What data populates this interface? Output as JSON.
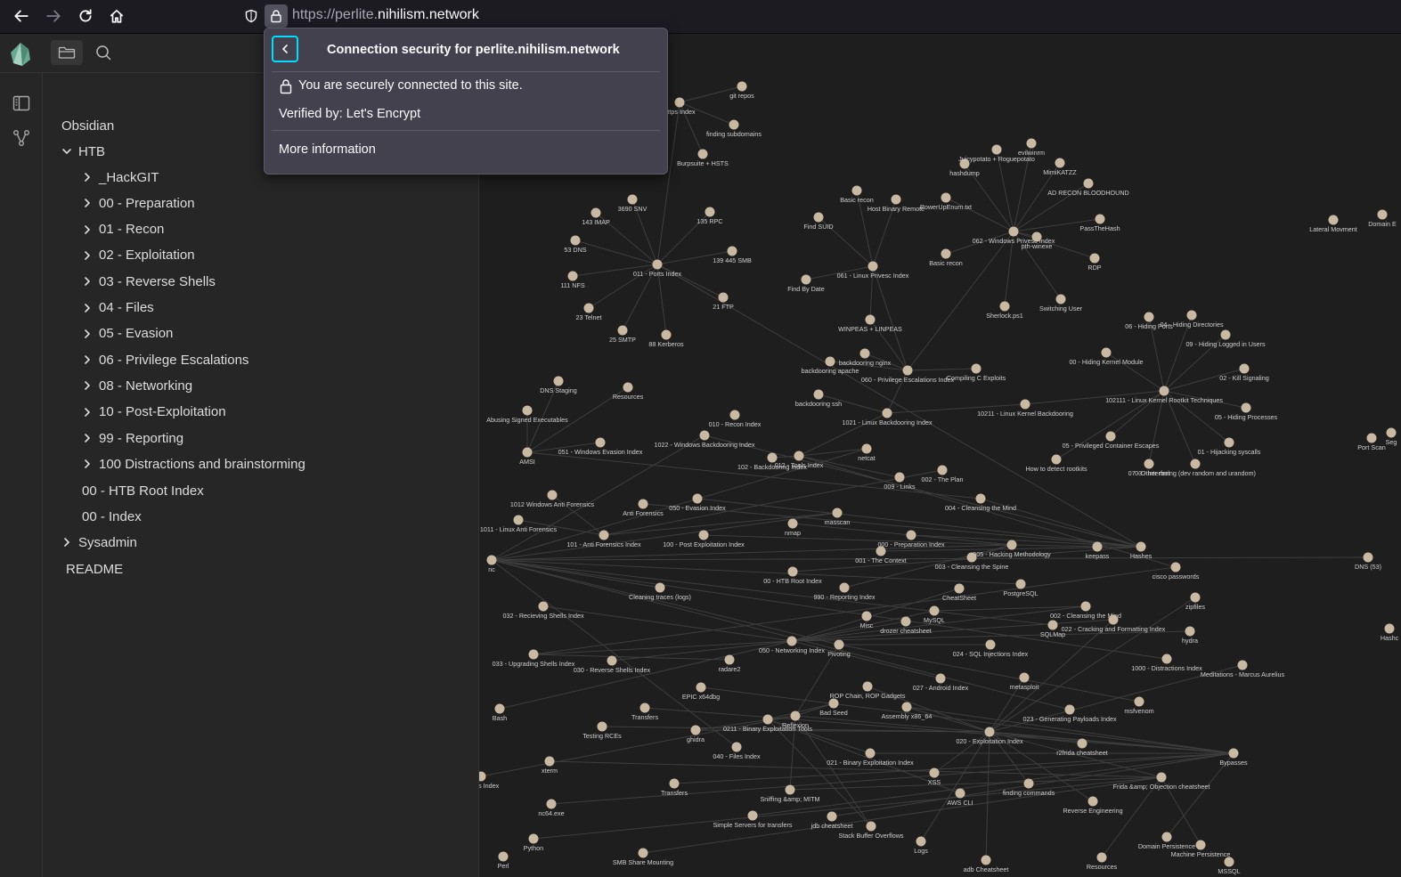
{
  "browser": {
    "url_dim_prefix": "https://perlite.",
    "url_domain": "nihilism.network"
  },
  "popup": {
    "title": "Connection security for perlite.nihilism.network",
    "secure_text": "You are securely connected to this site.",
    "verified_text": "Verified by: Let's Encrypt",
    "more_info": "More information"
  },
  "sidebar": {
    "root": "Obsidian",
    "htb": "HTB",
    "folders": [
      "_HackGIT",
      "00 - Preparation",
      "01 - Recon",
      "02 - Exploitation",
      "03 - Reverse Shells",
      "04 - Files",
      "05 - Evasion",
      "06 - Privilege Escalations",
      "08 - Networking",
      "10 - Post-Exploitation",
      "99 - Reporting",
      "100 Distractions and brainstorming"
    ],
    "files": [
      "00 - HTB Root Index",
      "00 - Index"
    ],
    "sysadmin": "Sysadmin",
    "readme": "README"
  },
  "graph": {
    "node_color": "#c9b9a3",
    "edge_color": "#3e3e3e",
    "label_color": "#cfcfcf",
    "nodes": [
      [
        "git repos",
        833,
        97
      ],
      [
        "https Index",
        763,
        115
      ],
      [
        "finding subdomains",
        824,
        140
      ],
      [
        "Burpsuite + HSTS",
        789,
        173
      ],
      [
        "3690 SNV",
        710,
        224
      ],
      [
        "143 IMAP",
        669,
        239
      ],
      [
        "135 RPC",
        797,
        238
      ],
      [
        "53 DNS",
        646,
        270
      ],
      [
        "139 445 SMB",
        822,
        282
      ],
      [
        "011 - Ports Index",
        738,
        297
      ],
      [
        "111 NFS",
        643,
        310
      ],
      [
        "21 FTP",
        812,
        334
      ],
      [
        "23 Telnet",
        661,
        346
      ],
      [
        "25 SMTP",
        699,
        371
      ],
      [
        "88 Kerberos",
        748,
        376
      ],
      [
        "hashdump",
        1083,
        184
      ],
      [
        "Juicypotato + Roguepotato",
        1119,
        168
      ],
      [
        "evilwinrm",
        1158,
        161
      ],
      [
        "MimiKATZZ",
        1190,
        183
      ],
      [
        "AD RECON BLOODHOUND",
        1222,
        206
      ],
      [
        "Basic recon",
        962,
        214
      ],
      [
        "Host Binary Remote",
        1006,
        224
      ],
      [
        "PowerUpEnum.txt",
        1062,
        222
      ],
      [
        "Find SUID",
        919,
        244
      ],
      [
        "PassTheHash",
        1235,
        246
      ],
      [
        "062 - Windows Privesc Index",
        1138,
        260
      ],
      [
        "pth-winexe",
        1164,
        266
      ],
      [
        "Basic recon",
        1062,
        285
      ],
      [
        "RDP",
        1229,
        290
      ],
      [
        "061 - Linux Privesc Index",
        980,
        299
      ],
      [
        "Find By Date",
        905,
        314
      ],
      [
        "Switching User",
        1191,
        336
      ],
      [
        "Sherlock.ps1",
        1128,
        344
      ],
      [
        "WINPEAS + LINPEAS",
        977,
        359
      ],
      [
        "backdooring nginx",
        971,
        397
      ],
      [
        "backdooring apache",
        932,
        406
      ],
      [
        "060 - Privilege Escalations Index",
        1019,
        416
      ],
      [
        "Compiling C Exploits",
        1096,
        414
      ],
      [
        "backdooring ssh",
        919,
        443
      ],
      [
        "1021 - Linux Backdooring Index",
        996,
        464
      ],
      [
        "10211 - Linux Kernel Backdooring",
        1151,
        454
      ],
      [
        "06 - Hiding Ports",
        1290,
        356
      ],
      [
        "04 - Hiding Directories",
        1338,
        354
      ],
      [
        "09 - Hiding Logged in Users",
        1376,
        376
      ],
      [
        "00 - Hiding Kernel Module",
        1242,
        396
      ],
      [
        "02 - Kill Signaling",
        1397,
        414
      ],
      [
        "102111 - Linux Kernel Rootkit Techniques",
        1307,
        439
      ],
      [
        "05 - Hiding Processes",
        1399,
        458
      ],
      [
        "05 - Privileged Container Escapes",
        1247,
        490
      ],
      [
        "01 - Hijacking syscalls",
        1380,
        497
      ],
      [
        "How to detect rootkits",
        1186,
        516
      ],
      [
        "07 - Other root",
        1290,
        521
      ],
      [
        "03 - Interfering (dev random and urandom)",
        1342,
        521
      ],
      [
        "DNS Staging",
        627,
        428
      ],
      [
        "Resources",
        705,
        435
      ],
      [
        "Abusing Signed Executables",
        592,
        461
      ],
      [
        "051 - Windows Evasion Index",
        674,
        497
      ],
      [
        "AMSI",
        592,
        508
      ],
      [
        "010 - Recon Index",
        825,
        466
      ],
      [
        "1022 - Windows Backdooring Index",
        791,
        489
      ],
      [
        "102 - Backdooring Index",
        867,
        514
      ],
      [
        "012 - Tools Index",
        897,
        512
      ],
      [
        "netcat",
        973,
        504
      ],
      [
        "009 - Links",
        1010,
        536
      ],
      [
        "002 - The Plan",
        1058,
        528
      ],
      [
        "1012 Windows Anti Forensics",
        620,
        556
      ],
      [
        "Anti Forensics",
        722,
        566
      ],
      [
        "050 - Evasion Index",
        783,
        560
      ],
      [
        "004 - Cleansing the Mind",
        1101,
        560
      ],
      [
        "1011 - Linux Anti Forensics",
        582,
        584
      ],
      [
        "nmap",
        890,
        588
      ],
      [
        "masscan",
        940,
        576
      ],
      [
        "101 - Anti Forensics Index",
        678,
        601
      ],
      [
        "100 - Post Exploitation Index",
        790,
        601
      ],
      [
        "000 - Preparation Index",
        1023,
        601
      ],
      [
        "001 - The Context",
        989,
        619
      ],
      [
        "005 - Hacking Methodology",
        1136,
        612
      ],
      [
        "003 - Cleansing the Spine",
        1091,
        626
      ],
      [
        "keepass",
        1232,
        614
      ],
      [
        "Hashes",
        1281,
        614
      ],
      [
        "cisco passwords",
        1320,
        637
      ],
      [
        "DNS (53)",
        1536,
        626
      ],
      [
        "nc",
        552,
        629
      ],
      [
        "00 - HTB Root Index",
        890,
        642
      ],
      [
        "Cleaning traces (logs)",
        741,
        660
      ],
      [
        "990 - Reporting Index",
        948,
        660
      ],
      [
        "CheatSheet",
        1077,
        661
      ],
      [
        "PostgreSQL",
        1146,
        656
      ],
      [
        "zipfiles",
        1342,
        671
      ],
      [
        "032 - Recieving Shells Index",
        610,
        681
      ],
      [
        "Misc",
        973,
        692
      ],
      [
        "drozer cheatsheet",
        1017,
        698
      ],
      [
        "MySQL",
        1049,
        686
      ],
      [
        "002 - Cleansing the Mind",
        1219,
        681
      ],
      [
        "022 - Cracking and Formatting Index",
        1250,
        696
      ],
      [
        "SQLMap",
        1182,
        702
      ],
      [
        "hydra",
        1336,
        709
      ],
      [
        "050 - Networking Index",
        889,
        720
      ],
      [
        "Pivoting",
        942,
        724
      ],
      [
        "024 - SQL Injections Index",
        1112,
        724
      ],
      [
        "033 - Upgrading Shells Index",
        599,
        735
      ],
      [
        "radare2",
        819,
        741
      ],
      [
        "030 - Reverse Shells Index",
        687,
        742
      ],
      [
        "1000 - Distractions Index",
        1310,
        740
      ],
      [
        "Meditations - Marcus Aurelius",
        1395,
        747
      ],
      [
        "027 - Android Index",
        1056,
        762
      ],
      [
        "metasploit",
        1150,
        761
      ],
      [
        "EPIC x64dbg",
        787,
        772
      ],
      [
        "ROP Chain, ROP Gadgets",
        974,
        771
      ],
      [
        "msfvenom",
        1279,
        788
      ],
      [
        "Bash",
        561,
        796
      ],
      [
        "Transfers",
        724,
        795
      ],
      [
        "Bad Seed",
        936,
        790
      ],
      [
        "Assembly x86_64",
        1018,
        794
      ],
      [
        "023 - Generating Payloads Index",
        1201,
        797
      ],
      [
        "0211 - Binary Exploitation Tools",
        862,
        808
      ],
      [
        "Reflexion",
        893,
        804
      ],
      [
        "Testing RCEs",
        676,
        816
      ],
      [
        "ghidra",
        781,
        820
      ],
      [
        "020 - Exploitation Index",
        1111,
        822
      ],
      [
        "r2frida cheatsheet",
        1215,
        835
      ],
      [
        "040 - Files Index",
        827,
        839
      ],
      [
        "Bypasses",
        1385,
        846
      ],
      [
        "021 - Binary Exploitation Index",
        977,
        846
      ],
      [
        "xterm",
        617,
        855
      ],
      [
        "XSS",
        1049,
        868
      ],
      [
        "Frida &amp; Objection cheatsheet",
        1304,
        873
      ],
      [
        "yloads Index",
        540,
        872
      ],
      [
        "finding commands",
        1155,
        880
      ],
      [
        "Transfers",
        757,
        880
      ],
      [
        "Sniffing &amp; MITM",
        887,
        887
      ],
      [
        "AWS CLI",
        1078,
        891
      ],
      [
        "Reverse Engineering",
        1227,
        900
      ],
      [
        "nc64.exe",
        619,
        903
      ],
      [
        "Simple Servers for transfers",
        845,
        916
      ],
      [
        "jdb cheatsheet",
        934,
        917
      ],
      [
        "Stack Buffer Overflows",
        978,
        928
      ],
      [
        "Python",
        599,
        942
      ],
      [
        "Logs",
        1034,
        945
      ],
      [
        "Domain Persistence",
        1310,
        940
      ],
      [
        "Machine Persistence",
        1348,
        949
      ],
      [
        "SMB Share Mounting",
        722,
        958
      ],
      [
        "Perl",
        565,
        962
      ],
      [
        "Resources",
        1237,
        963
      ],
      [
        "adb Cheatsheet",
        1107,
        966
      ],
      [
        "MSSQL",
        1380,
        968
      ],
      [
        "Lateral Movment",
        1497,
        247
      ],
      [
        "Domain E",
        1552,
        241
      ],
      [
        "Port Scan",
        1540,
        492
      ],
      [
        "Seg",
        1562,
        486
      ],
      [
        "Hashc",
        1560,
        706
      ]
    ],
    "edges": [
      [
        9,
        4
      ],
      [
        9,
        5
      ],
      [
        9,
        6
      ],
      [
        9,
        7
      ],
      [
        9,
        8
      ],
      [
        9,
        10
      ],
      [
        9,
        11
      ],
      [
        9,
        12
      ],
      [
        9,
        13
      ],
      [
        9,
        14
      ],
      [
        9,
        1
      ],
      [
        1,
        0
      ],
      [
        1,
        2
      ],
      [
        1,
        3
      ],
      [
        25,
        15
      ],
      [
        25,
        16
      ],
      [
        25,
        17
      ],
      [
        25,
        18
      ],
      [
        25,
        19
      ],
      [
        25,
        22
      ],
      [
        25,
        24
      ],
      [
        25,
        26
      ],
      [
        25,
        27
      ],
      [
        25,
        28
      ],
      [
        25,
        31
      ],
      [
        25,
        32
      ],
      [
        29,
        20
      ],
      [
        29,
        21
      ],
      [
        29,
        23
      ],
      [
        29,
        30
      ],
      [
        29,
        33
      ],
      [
        36,
        29
      ],
      [
        36,
        25
      ],
      [
        36,
        33
      ],
      [
        36,
        34
      ],
      [
        36,
        35
      ],
      [
        36,
        37
      ],
      [
        36,
        39
      ],
      [
        39,
        38
      ],
      [
        39,
        40
      ],
      [
        39,
        61
      ],
      [
        40,
        46
      ],
      [
        46,
        41
      ],
      [
        46,
        42
      ],
      [
        46,
        43
      ],
      [
        46,
        44
      ],
      [
        46,
        45
      ],
      [
        46,
        47
      ],
      [
        46,
        48
      ],
      [
        46,
        49
      ],
      [
        46,
        50
      ],
      [
        46,
        51
      ],
      [
        46,
        52
      ],
      [
        57,
        53
      ],
      [
        57,
        54
      ],
      [
        57,
        55
      ],
      [
        57,
        56
      ],
      [
        57,
        68
      ],
      [
        61,
        60
      ],
      [
        61,
        62
      ],
      [
        61,
        63
      ],
      [
        61,
        80
      ],
      [
        79,
        66
      ],
      [
        79,
        67
      ],
      [
        79,
        68
      ],
      [
        79,
        74
      ],
      [
        79,
        75
      ],
      [
        79,
        83
      ],
      [
        79,
        59
      ],
      [
        79,
        9
      ],
      [
        72,
        65
      ],
      [
        72,
        64
      ],
      [
        72,
        69
      ],
      [
        72,
        71
      ],
      [
        76,
        77
      ],
      [
        76,
        78
      ],
      [
        76,
        73
      ],
      [
        76,
        85
      ],
      [
        76,
        70
      ],
      [
        76,
        82
      ],
      [
        82,
        81
      ],
      [
        82,
        84
      ],
      [
        82,
        87
      ],
      [
        82,
        98
      ],
      [
        82,
        95
      ],
      [
        82,
        103
      ],
      [
        82,
        114
      ],
      [
        82,
        121
      ],
      [
        82,
        62
      ],
      [
        82,
        59
      ],
      [
        82,
        71
      ],
      [
        97,
        86
      ],
      [
        97,
        93
      ],
      [
        97,
        89
      ],
      [
        97,
        91
      ],
      [
        97,
        94
      ],
      [
        97,
        102
      ],
      [
        97,
        96
      ],
      [
        97,
        105
      ],
      [
        97,
        92
      ],
      [
        97,
        100
      ],
      [
        97,
        110
      ],
      [
        98,
        99
      ],
      [
        98,
        109
      ],
      [
        98,
        116
      ],
      [
        100,
        80
      ],
      [
        100,
        101
      ],
      [
        92,
        93
      ],
      [
        119,
        88
      ],
      [
        119,
        94
      ],
      [
        119,
        104
      ],
      [
        119,
        106
      ],
      [
        119,
        108
      ],
      [
        119,
        113
      ],
      [
        119,
        117
      ],
      [
        119,
        120
      ],
      [
        119,
        122
      ],
      [
        119,
        125
      ],
      [
        119,
        128
      ],
      [
        119,
        132
      ],
      [
        119,
        138
      ],
      [
        119,
        144
      ],
      [
        119,
        118
      ],
      [
        122,
        107
      ],
      [
        122,
        111
      ],
      [
        122,
        113
      ],
      [
        122,
        123
      ],
      [
        122,
        133
      ],
      [
        122,
        129
      ],
      [
        122,
        134
      ],
      [
        122,
        135
      ],
      [
        122,
        139
      ],
      [
        115,
        112
      ],
      [
        115,
        123
      ],
      [
        115,
        131
      ],
      [
        115,
        136
      ],
      [
        116,
        112
      ],
      [
        116,
        118
      ],
      [
        116,
        122
      ],
      [
        116,
        127
      ],
      [
        116,
        136
      ],
      [
        116,
        130
      ],
      [
        126,
        124
      ],
      [
        126,
        130
      ],
      [
        126,
        137
      ],
      [
        126,
        140
      ],
      [
        126,
        141
      ],
      [
        126,
        143
      ],
      [
        126,
        119
      ]
    ]
  }
}
